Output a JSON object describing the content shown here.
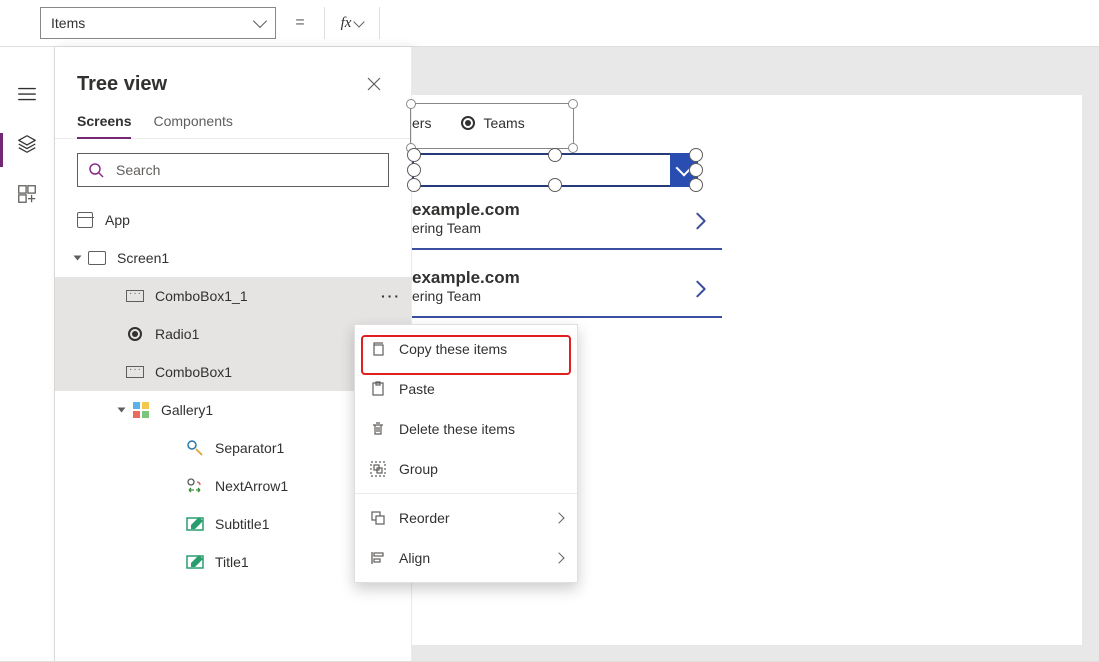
{
  "formula_bar": {
    "property_selected": "Items",
    "equals": "=",
    "fx_label": "fx",
    "formula_value": ""
  },
  "rail": {
    "items": [
      {
        "name": "hamburger-icon"
      },
      {
        "name": "layers-icon",
        "active": true
      },
      {
        "name": "insert-grid-icon"
      }
    ]
  },
  "tree_panel": {
    "title": "Tree view",
    "tabs": {
      "screens": "Screens",
      "components": "Components",
      "active": "screens"
    },
    "search_placeholder": "Search",
    "nodes": {
      "app": "App",
      "screen1": "Screen1",
      "combo1_1": "ComboBox1_1",
      "radio1": "Radio1",
      "combo1": "ComboBox1",
      "gallery1": "Gallery1",
      "separator1": "Separator1",
      "nextarrow1": "NextArrow1",
      "subtitle1": "Subtitle1",
      "title1": "Title1"
    }
  },
  "canvas": {
    "radio": {
      "opt1_partial": "ers",
      "opt2": "Teams"
    },
    "items": [
      {
        "title_partial": "example.com",
        "subtitle_partial": "ering Team"
      },
      {
        "title_partial": "example.com",
        "subtitle_partial": "ering Team"
      }
    ]
  },
  "context_menu": {
    "copy": "Copy these items",
    "paste": "Paste",
    "delete": "Delete these items",
    "group": "Group",
    "reorder": "Reorder",
    "align": "Align"
  }
}
